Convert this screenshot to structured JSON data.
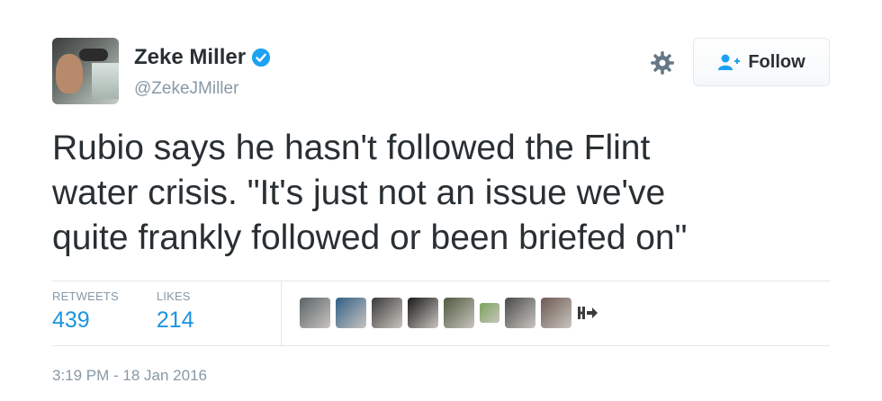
{
  "author": {
    "name": "Zeke Miller",
    "handle": "@ZekeJMiller",
    "verified": true,
    "verified_color": "#1da1f2"
  },
  "actions": {
    "follow_label": "Follow",
    "settings_icon": "gear-icon",
    "follow_icon": "add-user-icon"
  },
  "tweet": {
    "lines": [
      "Rubio says he hasn't followed the Flint",
      "water crisis. \"It's just not an issue we've",
      "quite frankly followed or been briefed on\""
    ]
  },
  "stats": {
    "retweets_label": "RETWEETS",
    "retweets_value": "439",
    "likes_label": "LIKES",
    "likes_value": "214",
    "value_color": "#1b95e0"
  },
  "likers": [
    {
      "color": "#5a6368"
    },
    {
      "color": "#2f5f86"
    },
    {
      "color": "#3b3b3b"
    },
    {
      "color": "#1a1a1a"
    },
    {
      "color": "#4e5a3e"
    },
    {
      "color": "#7ba35a"
    },
    {
      "color": "#4a4a4a"
    },
    {
      "color": "#6d5a52"
    }
  ],
  "timestamp": "3:19 PM - 18 Jan 2016"
}
